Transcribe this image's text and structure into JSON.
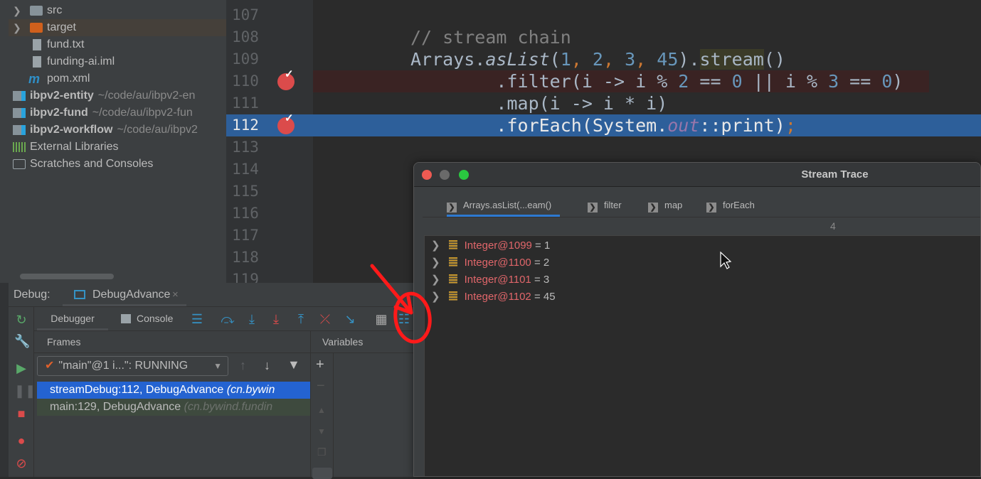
{
  "project_tree": [
    {
      "label": "src",
      "type": "folder",
      "expandable": true
    },
    {
      "label": "target",
      "type": "folder-excluded",
      "expandable": true,
      "selected": true
    },
    {
      "label": "fund.txt",
      "type": "text-file"
    },
    {
      "label": "funding-ai.iml",
      "type": "iml-file"
    },
    {
      "label": "pom.xml",
      "type": "maven-file"
    },
    {
      "label": "ibpv2-entity",
      "path": "~/code/au/ibpv2-en",
      "type": "module"
    },
    {
      "label": "ibpv2-fund",
      "path": "~/code/au/ibpv2-fun",
      "type": "module"
    },
    {
      "label": "ibpv2-workflow",
      "path": "~/code/au/ibpv2",
      "type": "module"
    },
    {
      "label": "External Libraries",
      "type": "libraries"
    },
    {
      "label": "Scratches and Consoles",
      "type": "scratches"
    }
  ],
  "editor": {
    "line_numbers": [
      "107",
      "108",
      "109",
      "110",
      "111",
      "112",
      "113",
      "114",
      "115",
      "116",
      "117",
      "118",
      "119"
    ],
    "breakpoint_lines": [
      "110",
      "112"
    ],
    "current_line": "112",
    "code": {
      "comment": "// stream chain",
      "l109_a": "Arrays.",
      "l109_b": "asList",
      "l109_c": "(",
      "nums": [
        "1",
        "2",
        "3",
        "45"
      ],
      "comma": ",",
      "l109_d": ").",
      "l109_e": "stream",
      "l109_f": "()",
      "l110_a": ".filter(i -> i % ",
      "l110_n1": "2",
      "l110_b": " == ",
      "l110_n2": "0",
      "l110_c": " || i % ",
      "l110_n3": "3",
      "l110_d": " == ",
      "l110_n4": "0",
      "l110_e": ")",
      "l111": ".map(i -> i * i)",
      "l112_a": ".forEach(System.",
      "l112_b": "out",
      "l112_c": "::print)",
      "l112_d": ";"
    }
  },
  "debug": {
    "label": "Debug:",
    "session_tab": "DebugAdvance",
    "tabs": [
      "Debugger",
      "Console"
    ],
    "frames_header": "Frames",
    "variables_header": "Variables",
    "thread_select": "\"main\"@1 i...\": RUNNING",
    "frames": [
      {
        "method": "streamDebug:112, DebugAdvance",
        "pkg": "(cn.bywin",
        "selected": true
      },
      {
        "method": "main:129, DebugAdvance",
        "pkg": "(cn.bywind.fundin",
        "selected": false
      }
    ]
  },
  "stream_trace": {
    "title": "Stream Trace",
    "tabs": [
      "Arrays.asList(...eam()",
      "filter",
      "map",
      "forEach"
    ],
    "active_tab": 0,
    "count": "4",
    "items": [
      {
        "ref": "Integer@1099",
        "value": "= 1"
      },
      {
        "ref": "Integer@1100",
        "value": "= 2"
      },
      {
        "ref": "Integer@1101",
        "value": "= 3"
      },
      {
        "ref": "Integer@1102",
        "value": "= 45"
      }
    ]
  },
  "colors": {
    "accent": "#2d5f9a",
    "annotation": "#ff1a1a",
    "breakpoint": "#db4b4b"
  }
}
